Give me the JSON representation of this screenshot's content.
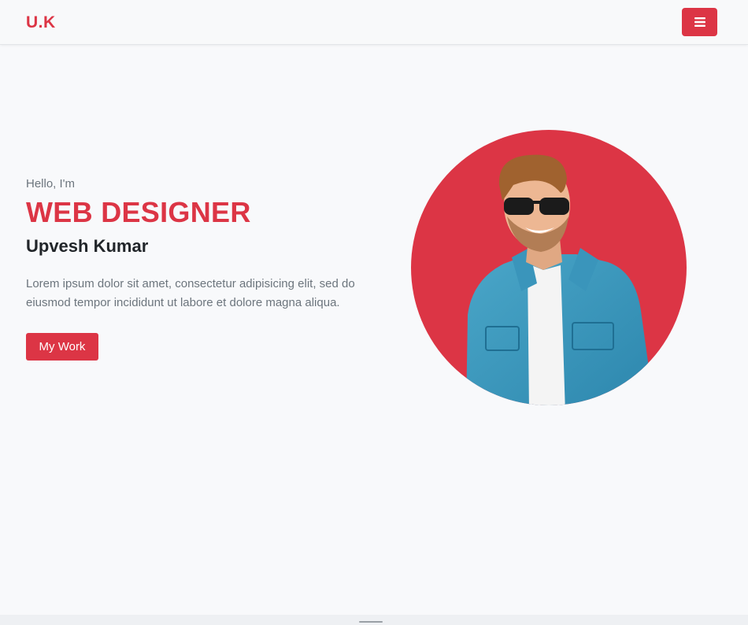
{
  "navbar": {
    "brand": "U.K",
    "menu_icon": "hamburger-icon"
  },
  "hero": {
    "greeting": "Hello, I'm",
    "title": "WEB DESIGNER",
    "name": "Upvesh Kumar",
    "description": "Lorem ipsum dolor sit amet, consectetur adipisicing elit, sed do eiusmod tempor incididunt ut labore et dolore magna aliqua.",
    "cta_label": "My Work"
  },
  "colors": {
    "accent": "#dc3545",
    "background": "#f8f9fb",
    "muted_text": "#6c757d"
  }
}
